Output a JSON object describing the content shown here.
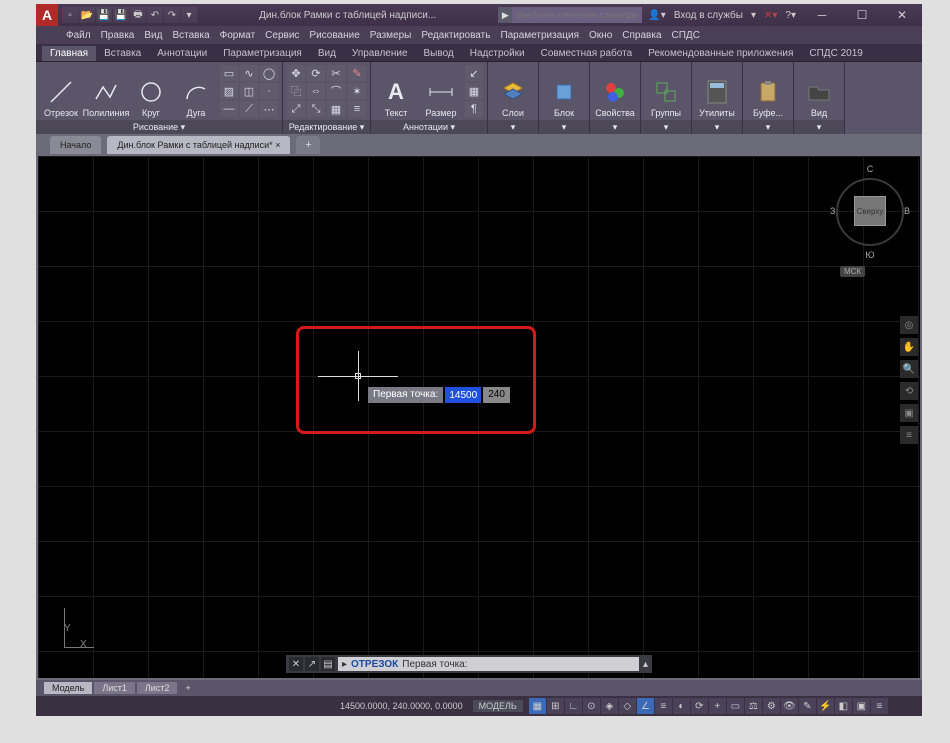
{
  "titlebar": {
    "logo": "A",
    "title": "Дин.блок Рамки с таблицей надписи...",
    "search_placeholder": "Введите ключевое слово/фразу",
    "signin": "Вход в службы",
    "qat": [
      "new",
      "open",
      "save",
      "saveas",
      "plot",
      "undo",
      "redo"
    ]
  },
  "menu": [
    "Файл",
    "Правка",
    "Вид",
    "Вставка",
    "Формат",
    "Сервис",
    "Рисование",
    "Размеры",
    "Редактировать",
    "Параметризация",
    "Окно",
    "Справка",
    "СПДС"
  ],
  "ribtabs": [
    "Главная",
    "Вставка",
    "Аннотации",
    "Параметризация",
    "Вид",
    "Управление",
    "Вывод",
    "Надстройки",
    "Совместная работа",
    "Рекомендованные приложения",
    "СПДС 2019"
  ],
  "panels": {
    "draw": {
      "title": "Рисование ▾",
      "items": [
        "Отрезок",
        "Полилиния",
        "Круг",
        "Дуга"
      ]
    },
    "modify": {
      "title": "Редактирование ▾"
    },
    "annot": {
      "title": "Аннотации ▾",
      "items": [
        "Текст",
        "Размер"
      ]
    },
    "layers": {
      "label": "Слои"
    },
    "block": {
      "label": "Блок"
    },
    "props": {
      "label": "Свойства"
    },
    "groups": {
      "label": "Группы"
    },
    "utils": {
      "label": "Утилиты"
    },
    "clip": {
      "label": "Буфе..."
    },
    "view": {
      "label": "Вид"
    }
  },
  "filetabs": {
    "t1": "Начало",
    "t2": "Дин.блок Рамки с таблицей надписи*",
    "add": "+"
  },
  "dyninput": {
    "label": "Первая точка:",
    "v1": "14500",
    "v2": "240"
  },
  "ucs": {
    "x": "X",
    "y": "Y"
  },
  "viewcube": {
    "top": "Сверху",
    "n": "С",
    "s": "Ю",
    "e": "В",
    "w": "З",
    "cs": "МСК"
  },
  "cmdline": {
    "cmd": "ОТРЕЗОК",
    "prompt": "Первая точка:"
  },
  "bottomtabs": [
    "Модель",
    "Лист1",
    "Лист2"
  ],
  "status": {
    "coords": "14500.0000, 240.0000, 0.0000",
    "mode": "МОДЕЛЬ"
  }
}
